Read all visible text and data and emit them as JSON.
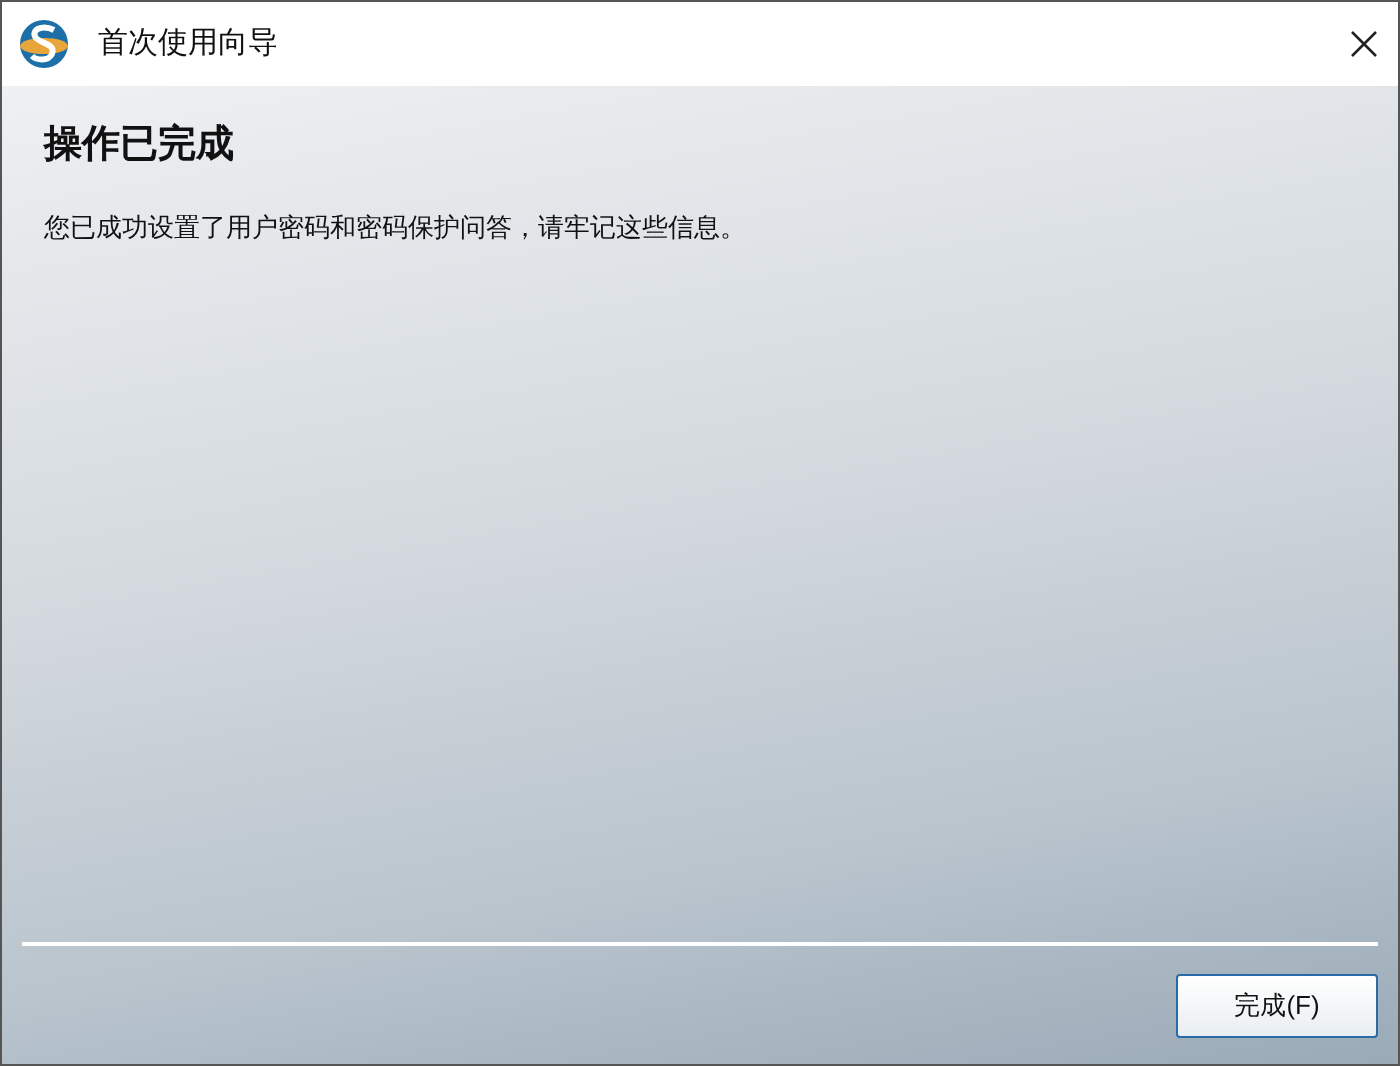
{
  "window": {
    "title": "首次使用向导"
  },
  "heading": "操作已完成",
  "message": "您已成功设置了用户密码和密码保护问答，请牢记这些信息。",
  "buttons": [
    {
      "label": "完成(F)",
      "selected": true
    }
  ]
}
